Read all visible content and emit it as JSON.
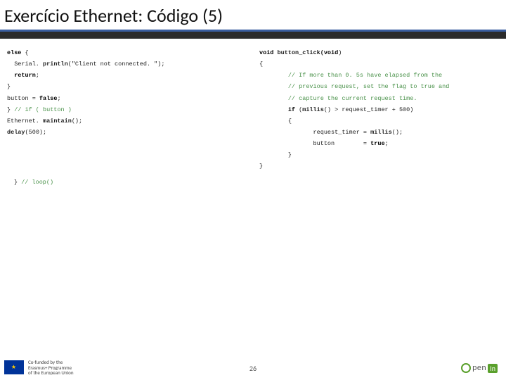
{
  "title": "Exercício Ethernet: Código (5)",
  "code_left": {
    "l1_kw": "else",
    "l1_rest": " {",
    "l2a": "Serial. ",
    "l2_fn": "println",
    "l2b": "(\"Client not connected. \");",
    "l3_kw": "return",
    "l3_rest": ";",
    "l4": "}",
    "l5a": "button = ",
    "l5_kw": "false",
    "l5b": ";",
    "l6a": "} ",
    "l6_cm": "// if ( button )",
    "l7a": "Ethernet. ",
    "l7_fn": "maintain",
    "l7b": "();",
    "l8_fn": "delay",
    "l8b": "(500);"
  },
  "closer_a": "} ",
  "closer_cm": "// loop()",
  "code_right": {
    "l1_kw1": "void",
    "l1_mid": " button_click(",
    "l1_kw2": "void",
    "l1_end": ")",
    "l2": "{",
    "l3_cm": "// If more than 0. 5s have elapsed from the",
    "l4_cm": "// previous request, set the flag to true and",
    "l5_cm": "// capture the current request time.",
    "l6_kw": "if",
    "l6_mid": " (",
    "l6_fn": "millis",
    "l6_rest": "() > request_timer + 500)",
    "l7": "{",
    "l8a": "request_timer = ",
    "l8_fn": "millis",
    "l8b": "();",
    "l9a": "button        = ",
    "l9_kw": "true",
    "l9b": ";",
    "l10": "}",
    "l11": "}"
  },
  "footer": {
    "eu_line1": "Co-funded by the",
    "eu_line2": "Erasmus+ Programme",
    "eu_line3": "of the European Union",
    "page_number": "26",
    "logo_pen": "pen",
    "logo_in": "In"
  }
}
